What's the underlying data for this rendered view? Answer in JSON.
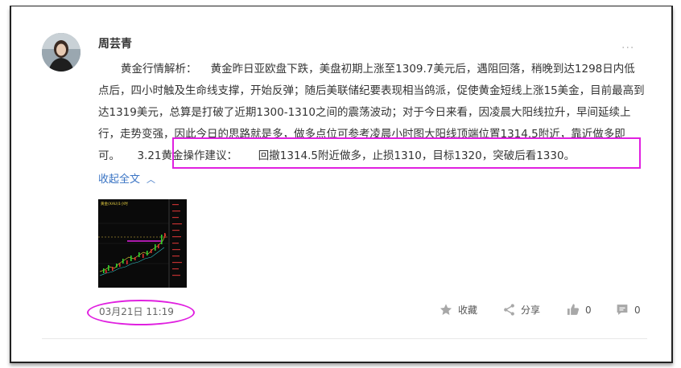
{
  "post": {
    "author": "周芸青",
    "more_icon": "···",
    "body_text": "黄金行情解析：    黄金昨日亚欧盘下跌，美盘初期上涨至1309.7美元后，遇阻回落，稍晚到达1298日内低点后，四小时触及生命线支撑，开始反弹；随后美联储纪要表现相当鸽派，促使黄金短线上涨15美金，目前最高到达1319美元，总算是打破了近期1300-1310之间的震荡波动；对于今日来看，因凌晨大阳线拉升，早间延续上行，走势变强，因此今日的思路就是多，做多点位可参考凌晨小时图大阳线顶端位置1314.5附近，靠近做多即可。     3.21黄金操作建议：      回撤1314.5附近做多，止损1310，目标1320，突破后看1330。",
    "collapse_label": "收起全文",
    "date": "03月21日 11:19",
    "thumbnail_label": "黄金(XAU)1小时"
  },
  "actions": {
    "favorite_label": "收藏",
    "share_label": "分享",
    "like_count": "0",
    "comment_count": "0"
  },
  "colors": {
    "highlight": "#e020e0",
    "link": "#3a74c4",
    "icon": "#a8a8a8"
  }
}
